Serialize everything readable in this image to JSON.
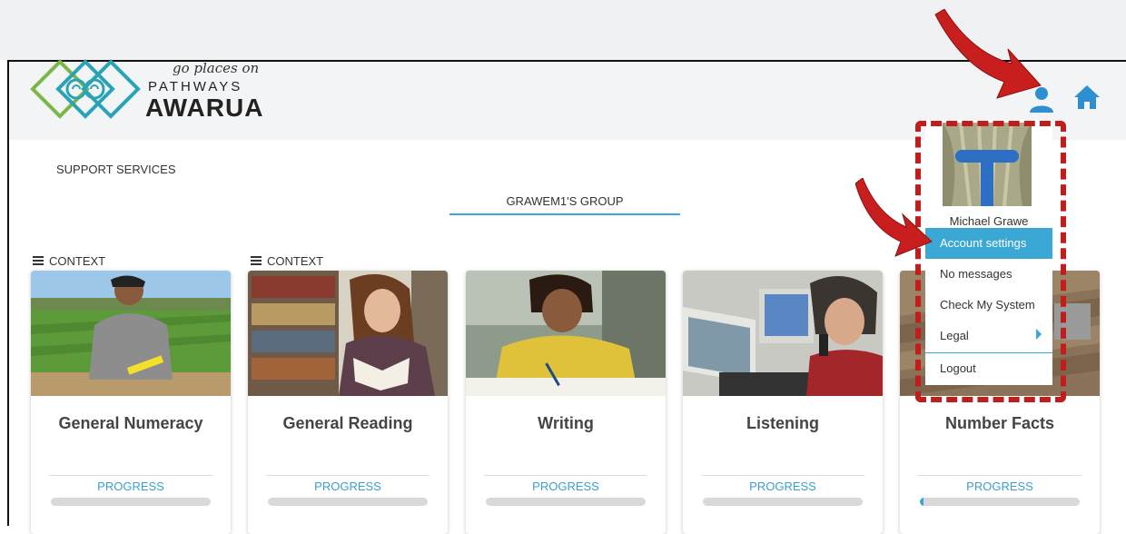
{
  "brand": {
    "tagline": "go places on",
    "line1": "PATHWAYS",
    "line2": "AWARUA"
  },
  "nav": {
    "support": "SUPPORT SERVICES",
    "group_tab": "GRAWEM1'S GROUP"
  },
  "contexts": [
    "CONTEXT",
    "CONTEXT"
  ],
  "modules": [
    {
      "title": "General Numeracy",
      "progress_label": "PROGRESS",
      "progress": 0
    },
    {
      "title": "General Reading",
      "progress_label": "PROGRESS",
      "progress": 0
    },
    {
      "title": "Writing",
      "progress_label": "PROGRESS",
      "progress": 0
    },
    {
      "title": "Listening",
      "progress_label": "PROGRESS",
      "progress": 0
    },
    {
      "title": "Number Facts",
      "progress_label": "PROGRESS",
      "progress": 0.02
    }
  ],
  "user_menu": {
    "name": "Michael Grawe",
    "items": [
      "Account settings",
      "No messages",
      "Check My System",
      "Legal",
      "Logout"
    ],
    "active": "Account settings"
  },
  "colors": {
    "accent": "#3aa7d4",
    "annotation": "#c01d1d",
    "logo_teal": "#2aa3b6",
    "logo_green": "#7ab648"
  },
  "icons": [
    "user-icon",
    "home-icon",
    "menu-icon",
    "chevron-right-icon"
  ]
}
